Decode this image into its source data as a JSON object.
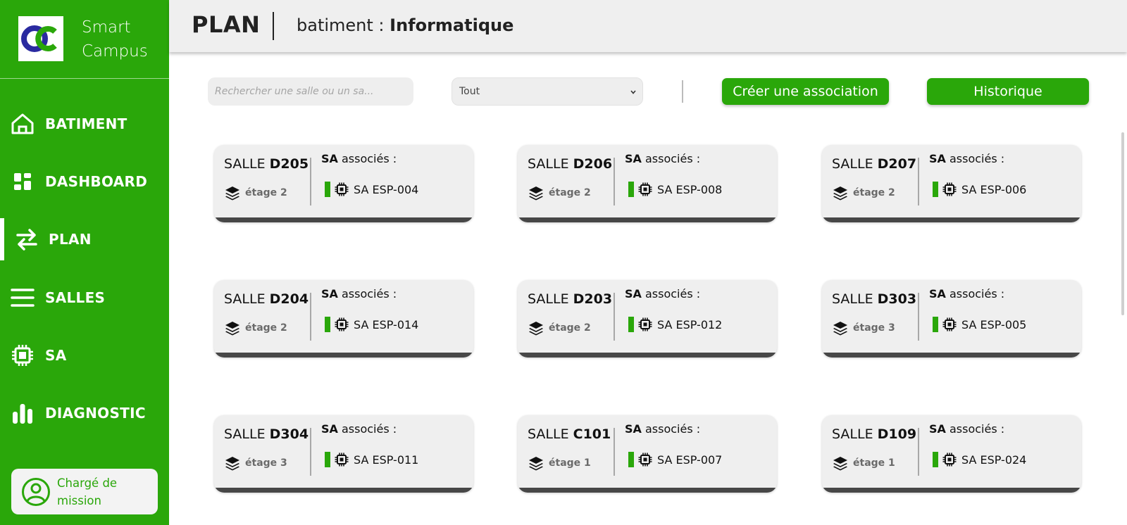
{
  "brand": {
    "name": "Smart\nCampus"
  },
  "nav": {
    "items": [
      {
        "label": "BATIMENT"
      },
      {
        "label": "DASHBOARD"
      },
      {
        "label": "PLAN"
      },
      {
        "label": "SALLES"
      },
      {
        "label": "SA"
      },
      {
        "label": "DIAGNOSTIC"
      }
    ],
    "active": "PLAN"
  },
  "user": {
    "role": "Chargé de mission"
  },
  "header": {
    "title": "PLAN",
    "building_prefix": "batiment : ",
    "building_name": "Informatique"
  },
  "toolbar": {
    "search_placeholder": "Rechercher une salle ou un sa...",
    "filter_value": "Tout",
    "create_label": "Créer une association",
    "history_label": "Historique"
  },
  "cards": {
    "room_prefix": "SALLE ",
    "assoc_bold": "SA",
    "assoc_rest": " associés :",
    "items": [
      {
        "code": "D205",
        "floor": "étage 2",
        "sa": "SA ESP-004"
      },
      {
        "code": "D206",
        "floor": "étage 2",
        "sa": "SA ESP-008"
      },
      {
        "code": "D207",
        "floor": "étage 2",
        "sa": "SA ESP-006"
      },
      {
        "code": "D204",
        "floor": "étage 2",
        "sa": "SA ESP-014"
      },
      {
        "code": "D203",
        "floor": "étage 2",
        "sa": "SA ESP-012"
      },
      {
        "code": "D303",
        "floor": "étage 3",
        "sa": "SA ESP-005"
      },
      {
        "code": "D304",
        "floor": "étage 3",
        "sa": "SA ESP-011"
      },
      {
        "code": "C101",
        "floor": "étage 1",
        "sa": "SA ESP-007"
      },
      {
        "code": "D109",
        "floor": "étage 1",
        "sa": "SA ESP-024"
      }
    ]
  },
  "colors": {
    "accent": "#2aa70a",
    "logo_blue": "#2a2aa0",
    "header_bg": "#efefef",
    "card_bg": "#efefef"
  },
  "icons": {
    "nav": [
      "home-icon",
      "dashboard-icon",
      "arrows-swap-icon",
      "menu-lines-icon",
      "chip-icon",
      "bar-chart-icon"
    ],
    "floor": "layers-icon",
    "sa": "chip-icon",
    "user": "user-circle-icon"
  }
}
